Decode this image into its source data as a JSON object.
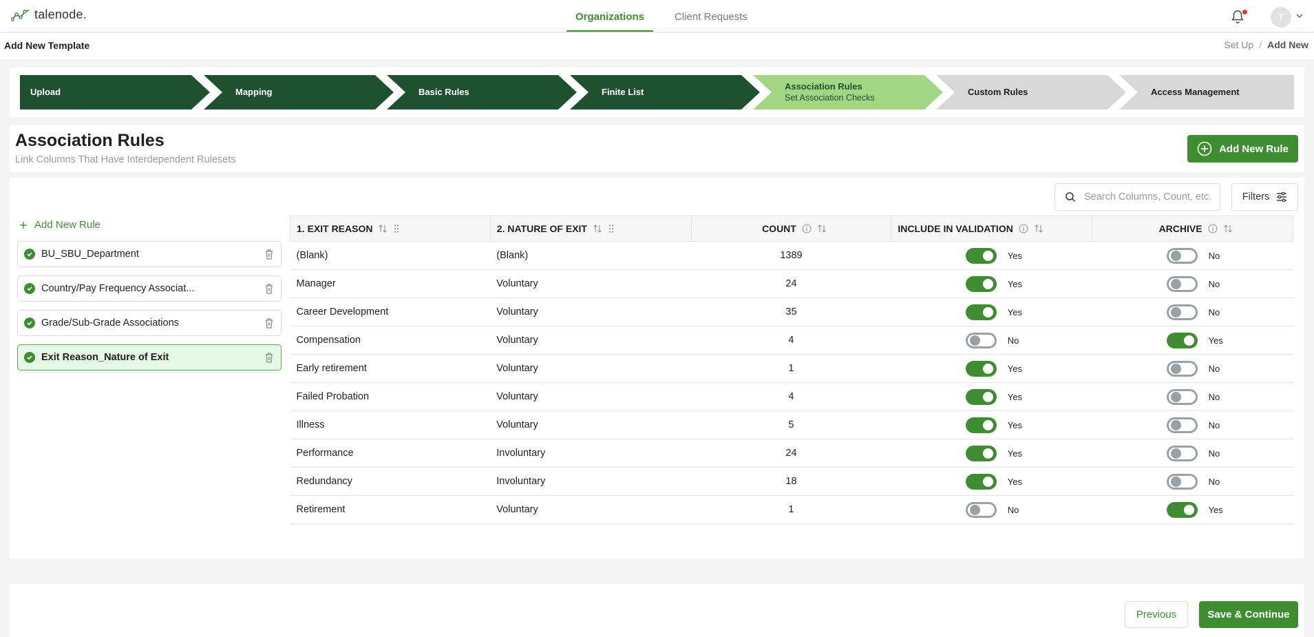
{
  "app": {
    "logo_text": "talenode."
  },
  "nav": {
    "tabs": [
      {
        "label": "Organizations"
      },
      {
        "label": "Client Requests"
      }
    ]
  },
  "user": {
    "avatar_initial": "T"
  },
  "header": {
    "title": "Add New Template",
    "breadcrumb": [
      "Set Up",
      "Add New"
    ]
  },
  "stepper": {
    "steps": [
      {
        "label": "Upload",
        "state": "done"
      },
      {
        "label": "Mapping",
        "state": "done"
      },
      {
        "label": "Basic Rules",
        "state": "done"
      },
      {
        "label": "Finite List",
        "state": "done"
      },
      {
        "label": "Association Rules",
        "sub": "Set Association Checks",
        "state": "current"
      },
      {
        "label": "Custom Rules",
        "state": "pending"
      },
      {
        "label": "Access Management",
        "state": "pending"
      }
    ]
  },
  "section": {
    "title": "Association Rules",
    "subtitle": "Link Columns That Have Interdependent Rulesets",
    "add_button": "Add New Rule"
  },
  "toolbar": {
    "search_placeholder": "Search Columns, Count, etc.",
    "filters_label": "Filters"
  },
  "rules": {
    "add_label": "Add New Rule",
    "items": [
      {
        "label": "BU_SBU_Department"
      },
      {
        "label": "Country/Pay Frequency Associat..."
      },
      {
        "label": "Grade/Sub-Grade Associations"
      },
      {
        "label": "Exit Reason_Nature of Exit",
        "active": true
      }
    ]
  },
  "table": {
    "columns": [
      "1. EXIT REASON",
      "2. NATURE OF EXIT",
      "COUNT",
      "INCLUDE IN VALIDATION",
      "ARCHIVE"
    ],
    "rows": [
      {
        "reason": "(Blank)",
        "nature": "(Blank)",
        "count": "1389",
        "include": true,
        "include_label": "Yes",
        "archive": false,
        "archive_label": "No"
      },
      {
        "reason": "Manager",
        "nature": "Voluntary",
        "count": "24",
        "include": true,
        "include_label": "Yes",
        "archive": false,
        "archive_label": "No"
      },
      {
        "reason": "Career Development",
        "nature": "Voluntary",
        "count": "35",
        "include": true,
        "include_label": "Yes",
        "archive": false,
        "archive_label": "No"
      },
      {
        "reason": "Compensation",
        "nature": "Voluntary",
        "count": "4",
        "include": false,
        "include_label": "No",
        "archive": true,
        "archive_label": "Yes"
      },
      {
        "reason": "Early retirement",
        "nature": "Voluntary",
        "count": "1",
        "include": true,
        "include_label": "Yes",
        "archive": false,
        "archive_label": "No"
      },
      {
        "reason": "Failed Probation",
        "nature": "Voluntary",
        "count": "4",
        "include": true,
        "include_label": "Yes",
        "archive": false,
        "archive_label": "No"
      },
      {
        "reason": "Illness",
        "nature": "Voluntary",
        "count": "5",
        "include": true,
        "include_label": "Yes",
        "archive": false,
        "archive_label": "No"
      },
      {
        "reason": "Performance",
        "nature": "Involuntary",
        "count": "24",
        "include": true,
        "include_label": "Yes",
        "archive": false,
        "archive_label": "No"
      },
      {
        "reason": "Redundancy",
        "nature": "Involuntary",
        "count": "18",
        "include": true,
        "include_label": "Yes",
        "archive": false,
        "archive_label": "No"
      },
      {
        "reason": "Retirement",
        "nature": "Voluntary",
        "count": "1",
        "include": false,
        "include_label": "No",
        "archive": true,
        "archive_label": "Yes"
      }
    ]
  },
  "footer": {
    "previous_label": "Previous",
    "save_label": "Save & Continue"
  },
  "colors": {
    "accent": "#3e8e31",
    "step_done": "#1f5130",
    "step_current": "#a3d683",
    "step_pending": "#d8d8d8"
  },
  "icons": [
    "logo-icon",
    "bell-icon",
    "chevron-down-icon",
    "add-circle-icon",
    "search-icon",
    "filters-icon",
    "plus-icon",
    "check-circle-icon",
    "trash-icon",
    "sort-icon",
    "drag-icon",
    "info-icon"
  ]
}
